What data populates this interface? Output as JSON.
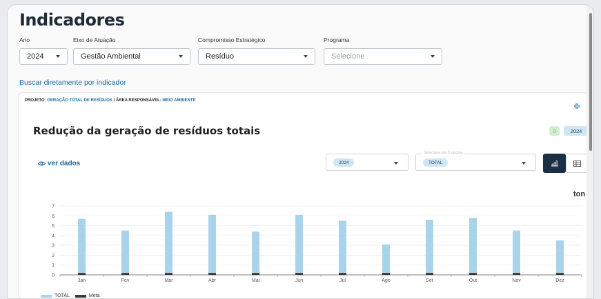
{
  "page": {
    "title": "Indicadores"
  },
  "filters": [
    {
      "label": "Ano",
      "value": "2024",
      "placeholder": ""
    },
    {
      "label": "Eixo de Atuação",
      "value": "Gestão Ambiental",
      "placeholder": ""
    },
    {
      "label": "Compromisso Estratégico",
      "value": "Resíduo",
      "placeholder": ""
    },
    {
      "label": "Programa",
      "value": "",
      "placeholder": "Selecione"
    }
  ],
  "direct_link": "Buscar diretamente por indicador",
  "card": {
    "project_prefix": "PROJETO:",
    "project_name": "GERAÇÃO TOTAL DE RESÍDUOS",
    "area_prefix": "/ ÁREA RESPONSÁVEL:",
    "area_name": "MEIO AMBIENTE",
    "indicator_title": "Redução da geração de resíduos totais",
    "badges": [
      "0",
      "2024"
    ],
    "ver_dados": "ver dados",
    "year_combo": {
      "chip": "2024"
    },
    "series_combo": {
      "label": "Selecione até 3 opções",
      "chip": "TOTAL"
    },
    "unit": "ton"
  },
  "colors": {
    "total": "#a9d3ea",
    "meta": "#3a3a3a",
    "accent": "#1a6aa0",
    "dark": "#1b2f45"
  },
  "icons": [
    "eye-icon",
    "collapse-icon",
    "bar-chart-icon",
    "table-icon",
    "chevron-down-icon"
  ],
  "chart_data": {
    "type": "bar",
    "categories": [
      "Jan",
      "Fev",
      "Mar",
      "Abr",
      "Mai",
      "Jun",
      "Jul",
      "Ago",
      "Set",
      "Out",
      "Nov",
      "Dez"
    ],
    "series": [
      {
        "name": "TOTAL",
        "values": [
          5.7,
          4.5,
          6.4,
          6.1,
          4.4,
          6.1,
          5.5,
          3.1,
          5.6,
          5.8,
          4.5,
          3.5
        ]
      },
      {
        "name": "Meta",
        "values": [
          0.1,
          0.1,
          0.1,
          0.1,
          0.1,
          0.1,
          0.1,
          0.1,
          0.1,
          0.1,
          0.1,
          0.1
        ]
      }
    ],
    "yticks": [
      0,
      1,
      2,
      3,
      4,
      5,
      6,
      7
    ],
    "ylim": [
      0,
      7
    ],
    "ylabel": "ton",
    "grid": true,
    "legend": "bottom-left"
  }
}
